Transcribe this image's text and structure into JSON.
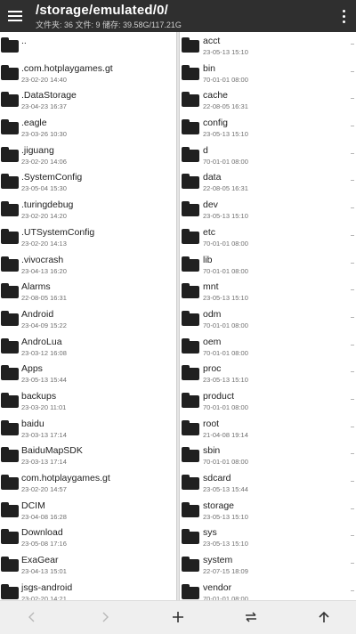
{
  "header": {
    "path": "/storage/emulated/0/",
    "stats": "文件夹: 36  文件: 9  储存: 39.58G/117.21G"
  },
  "left_pane": [
    {
      "name": "..",
      "date": ""
    },
    {
      "name": ".com.hotplaygames.gt",
      "date": "23-02-20 14:40"
    },
    {
      "name": ".DataStorage",
      "date": "23-04-23 16:37"
    },
    {
      "name": ".eagle",
      "date": "23-03-26 10:30"
    },
    {
      "name": ".jiguang",
      "date": "23-02-20 14:06"
    },
    {
      "name": ".SystemConfig",
      "date": "23-05-04 15:30"
    },
    {
      "name": ".turingdebug",
      "date": "23-02-20 14:20"
    },
    {
      "name": ".UTSystemConfig",
      "date": "23-02-20 14:13"
    },
    {
      "name": ".vivocrash",
      "date": "23-04-13 16:20"
    },
    {
      "name": "Alarms",
      "date": "22-08-05 16:31"
    },
    {
      "name": "Android",
      "date": "23-04-09 15:22"
    },
    {
      "name": "AndroLua",
      "date": "23-03-12 16:08"
    },
    {
      "name": "Apps",
      "date": "23-05-13 15:44"
    },
    {
      "name": "backups",
      "date": "23-03-20 11:01"
    },
    {
      "name": "baidu",
      "date": "23-03-13 17:14"
    },
    {
      "name": "BaiduMapSDK",
      "date": "23-03-13 17:14"
    },
    {
      "name": "com.hotplaygames.gt",
      "date": "23-02-20 14:57"
    },
    {
      "name": "DCIM",
      "date": "23-04-08 16:28"
    },
    {
      "name": "Download",
      "date": "23-05-08 17:16"
    },
    {
      "name": "ExaGear",
      "date": "23-04-13 15:01"
    },
    {
      "name": "jsgs-android",
      "date": "23-02-20 14:21"
    }
  ],
  "right_pane": [
    {
      "name": "acct",
      "date": "23-05-13 15:10"
    },
    {
      "name": "bin",
      "date": "70-01-01 08:00"
    },
    {
      "name": "cache",
      "date": "22-08-05 16:31"
    },
    {
      "name": "config",
      "date": "23-05-13 15:10"
    },
    {
      "name": "d",
      "date": "70-01-01 08:00"
    },
    {
      "name": "data",
      "date": "22-08-05 16:31"
    },
    {
      "name": "dev",
      "date": "23-05-13 15:10"
    },
    {
      "name": "etc",
      "date": "70-01-01 08:00"
    },
    {
      "name": "lib",
      "date": "70-01-01 08:00"
    },
    {
      "name": "mnt",
      "date": "23-05-13 15:10"
    },
    {
      "name": "odm",
      "date": "70-01-01 08:00"
    },
    {
      "name": "oem",
      "date": "70-01-01 08:00"
    },
    {
      "name": "proc",
      "date": "23-05-13 15:10"
    },
    {
      "name": "product",
      "date": "70-01-01 08:00"
    },
    {
      "name": "root",
      "date": "21-04-08 19:14"
    },
    {
      "name": "sbin",
      "date": "70-01-01 08:00"
    },
    {
      "name": "sdcard",
      "date": "23-05-13 15:44"
    },
    {
      "name": "storage",
      "date": "23-05-13 15:10"
    },
    {
      "name": "sys",
      "date": "23-05-13 15:10"
    },
    {
      "name": "system",
      "date": "22-07-15 18:09"
    },
    {
      "name": "vendor",
      "date": "70-01-01 08:00"
    }
  ],
  "icons": {
    "menu": "menu-icon",
    "more": "more-vert-icon",
    "folder": "folder-icon",
    "back": "chevron-left-icon",
    "forward": "chevron-right-icon",
    "add": "plus-icon",
    "swap": "swap-icon",
    "up": "arrow-up-icon"
  },
  "colors": {
    "topbar": "#2f2f2f",
    "folder": "#202020",
    "bottombar": "#efefef"
  }
}
